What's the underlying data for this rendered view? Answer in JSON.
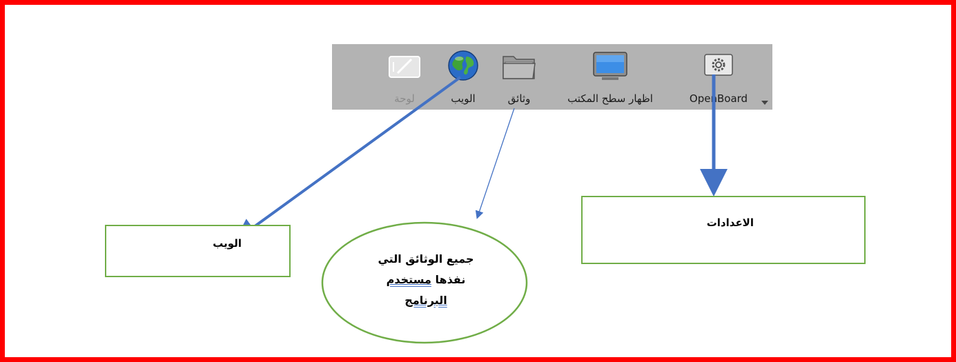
{
  "toolbar": {
    "items": [
      {
        "label": "لوحة",
        "icon": "board-icon",
        "enabled": false
      },
      {
        "label": "الويب",
        "icon": "globe-icon",
        "enabled": true
      },
      {
        "label": "وثائق",
        "icon": "folder-icon",
        "enabled": true
      },
      {
        "label": "اظهار سطح المكتب",
        "icon": "monitor-icon",
        "enabled": true
      },
      {
        "label": "OpenBoard",
        "icon": "gear-icon",
        "enabled": true
      }
    ],
    "menu_icon": "chevron-down-icon"
  },
  "callouts": {
    "web": "الويب",
    "settings": "الاعدادات",
    "documents": {
      "line1": "جميع الوثائق التي",
      "line2_plain": "نفذها ",
      "line2_underlined": "مستخدم",
      "line3_underlined": "البرنامج"
    }
  },
  "colors": {
    "frame": "#ff0000",
    "toolbar": "#b3b3b3",
    "box_border": "#70ad47",
    "arrow": "#4472c4"
  }
}
